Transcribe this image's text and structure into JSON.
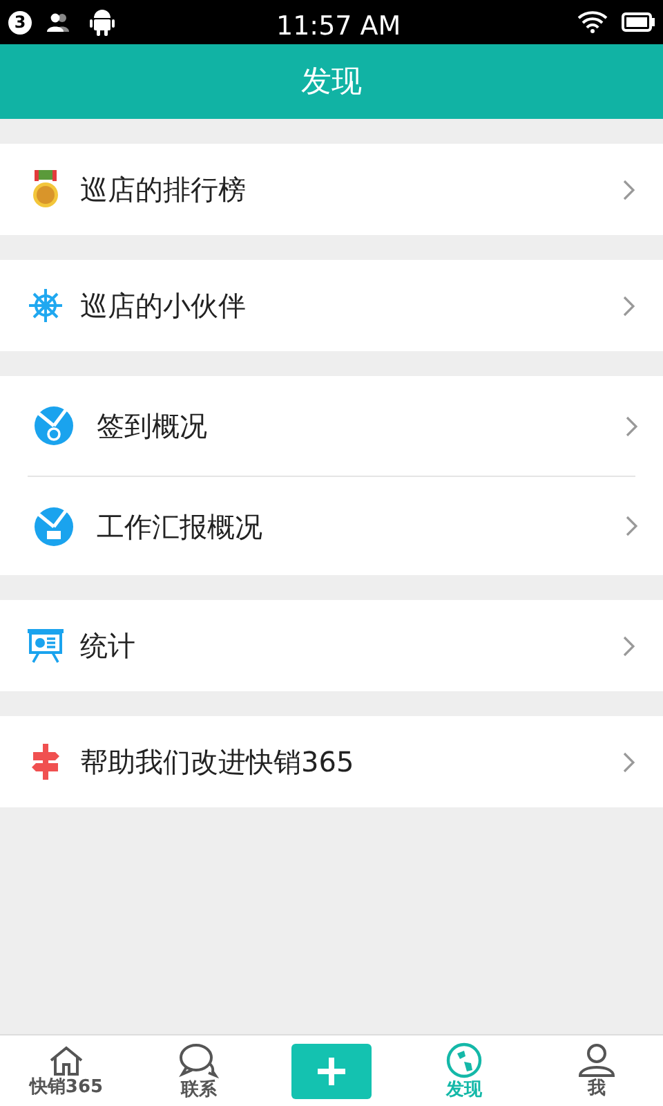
{
  "status_bar": {
    "badge": "3",
    "time": "11:57 AM"
  },
  "header": {
    "title": "发现"
  },
  "sections": [
    {
      "items": [
        {
          "kind": "medal",
          "label": "巡店的排行榜"
        }
      ]
    },
    {
      "items": [
        {
          "kind": "wheel",
          "label": "巡店的小伙伴"
        }
      ]
    },
    {
      "items": [
        {
          "kind": "pin",
          "label": "签到概况"
        },
        {
          "kind": "report",
          "label": "工作汇报概况"
        }
      ]
    },
    {
      "items": [
        {
          "kind": "board",
          "label": "统计"
        }
      ]
    },
    {
      "items": [
        {
          "kind": "sign",
          "label": "帮助我们改进快销365"
        }
      ]
    }
  ],
  "tab_bar": [
    {
      "kind": "home",
      "label": "快销365",
      "selected": false
    },
    {
      "kind": "chat",
      "label": "联系",
      "selected": false
    },
    {
      "kind": "add",
      "selected": false
    },
    {
      "kind": "globe",
      "label": "发现",
      "selected": true
    },
    {
      "kind": "person",
      "label": "我",
      "selected": false
    }
  ]
}
